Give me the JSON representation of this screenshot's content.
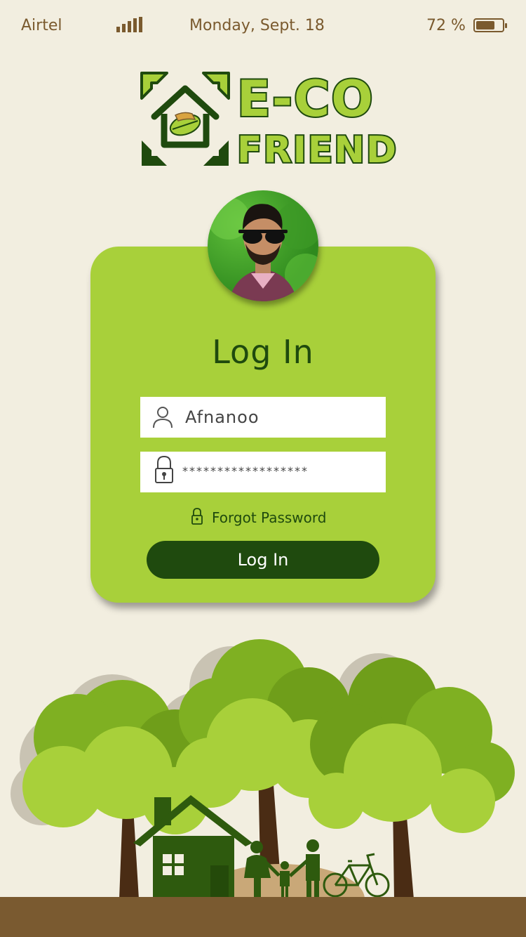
{
  "status_bar": {
    "carrier": "Airtel",
    "date": "Monday, Sept. 18",
    "battery_percent": "72 %",
    "battery_level": 0.72,
    "signal_icon": "signal-bars-icon",
    "battery_icon": "battery-icon"
  },
  "logo": {
    "line1": "E-CO",
    "line2": "FRIEND",
    "icon": "eco-house-leaf-icon"
  },
  "login": {
    "title": "Log In",
    "username": "Afnanoo",
    "password_mask": "******************",
    "forgot_label": "Forgot Password",
    "button_label": "Log In",
    "user_icon": "user-icon",
    "lock_icon": "lock-icon"
  },
  "colors": {
    "background": "#f2eee0",
    "accent_green": "#a8d03a",
    "dark_green": "#1f4a0e",
    "brown": "#7a5a2e"
  }
}
